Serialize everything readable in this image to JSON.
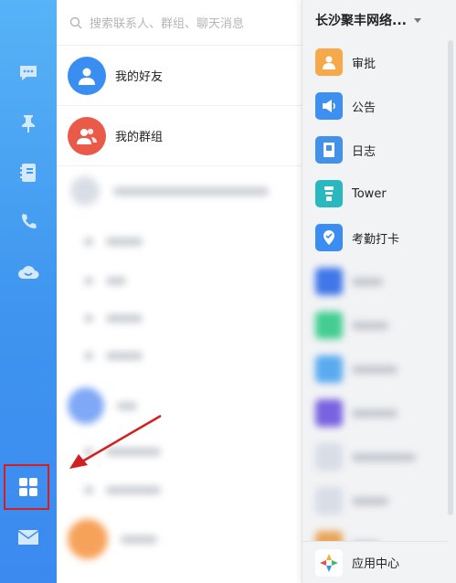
{
  "rail": {
    "icons": [
      "chat-icon",
      "pin-icon",
      "contacts-book-icon",
      "phone-icon",
      "cloud-icon",
      "apps-grid-icon",
      "mail-icon"
    ]
  },
  "search": {
    "placeholder": "搜索联系人、群组、聊天消息"
  },
  "contacts": {
    "friends": "我的好友",
    "groups": "我的群组"
  },
  "panel": {
    "org_name": "长沙聚丰网络...",
    "apps": [
      {
        "label": "审批",
        "color": "#f5a94a",
        "icon": "approval-icon"
      },
      {
        "label": "公告",
        "color": "#3d8ff0",
        "icon": "announcement-icon"
      },
      {
        "label": "日志",
        "color": "#4391e8",
        "icon": "log-icon"
      },
      {
        "label": "Tower",
        "color": "#29b8c0",
        "icon": "tower-icon"
      },
      {
        "label": "考勤打卡",
        "color": "#3c8df1",
        "icon": "attendance-icon"
      }
    ],
    "app_center": "应用中心"
  },
  "colors": {
    "rail_top": "#57b3f6",
    "rail_bottom": "#3c8af0",
    "friends_avatar": "#3b8ef1",
    "groups_avatar": "#ea5a48",
    "annotation": "#d21f1f"
  }
}
